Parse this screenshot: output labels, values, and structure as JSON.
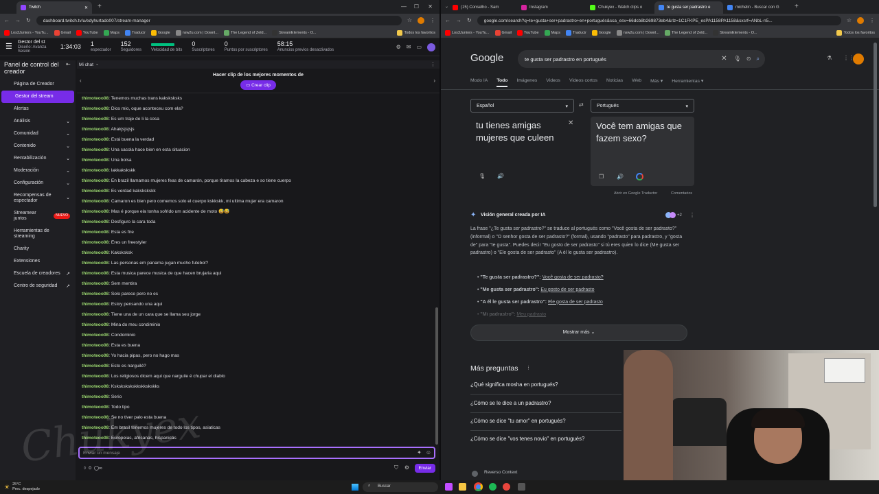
{
  "left_browser": {
    "tab_title": "Twitch",
    "url": "dashboard.twitch.tv/u/edyhurtado007/stream-manager",
    "bookmarks": [
      "Los3Juniors - YouTu...",
      "Gmail",
      "YouTube",
      "Maps",
      "Traducir",
      "Google",
      "nsw2u.com | Downl...",
      "The Legend of Zeld...",
      "StreamElements - O..."
    ],
    "all_bookmarks": "Todos los favoritos"
  },
  "twitch": {
    "header_title": "Gestor del st",
    "header_sub1": "Diseño: Avanza",
    "header_sub2": "Sesión",
    "stats": [
      {
        "value": "1:34:03",
        "label": ""
      },
      {
        "value": "1",
        "label": "espectador"
      },
      {
        "value": "152",
        "label": "Seguidores"
      },
      {
        "value": "",
        "label": "Velocidad de bits"
      },
      {
        "value": "0",
        "label": "Suscriptores"
      },
      {
        "value": "0",
        "label": "Puntos por suscriptores"
      },
      {
        "value": "58:15",
        "label": "Anuncios previos desactivados"
      }
    ],
    "sidebar_title": "Panel de control del creador",
    "sidebar_items": [
      "Página de Creador",
      "Gestor del stream",
      "Alertas",
      "Análisis",
      "Comunidad",
      "Contenido",
      "Rentabilización",
      "Moderación",
      "Configuración",
      "Recompensas de espectador",
      "Streamear juntos",
      "Herramientas de streaming",
      "Charity",
      "Extensiones",
      "Escuela de creadores",
      "Centro de seguridad"
    ],
    "new_badge": "NUEVO",
    "chat_header": "Mi chat",
    "clip_prompt": "Hacer clip de los mejores momentos de",
    "clip_button": "Crear clip",
    "username": "thimoteoo08",
    "messages": [
      "Tenemos muchas trans kaksksksks",
      "Dios mio, oque aconteceu com ela?",
      "Es um traje de li la cosa",
      "Ahakjsjsjsjs",
      "Está buena la verdad",
      "Una sacola hace bien en esta situacion",
      "Una bolsa",
      "lakkakskskk",
      "En brazil llamamos mujeres feas de camarón, porque tiramos la cabeza e so tiene cuerpo",
      "Es verdad kakskskskk",
      "Camaron es bien pero comemos solo el cuerpo kskkskk, mi ultima mujer era camaron",
      "Mas é porque ela tonha sofrido um acidente de moto 😅😅",
      "Desfiguro la cara toda",
      "Esta es fire",
      "Eres un freestyler",
      "Kaksksksk",
      "Las personas em panama jugan mucho futebol?",
      "Esta musica parece musica de que hacen brujaria aqui",
      "Sem mentira",
      "Solo parece pero no es",
      "Estoy pensando una aqui",
      "Tiene una de un cara que se llama seu jorge",
      "Mina do meu condiminio",
      "Condominio",
      "Esta es buena",
      "Yo hacia pipas, pero no hago mas",
      "Esto es narguilé?",
      "Los religiosos dicem aqui que narguile é chupar el diablo",
      "Kskskskskskkskkskskks",
      "Serio",
      "Todo tipo",
      "Se no tiver palo esta buena",
      "Em brasil tenemos mujeres de todo los tipos, asiaticas",
      "Europeias, africanas, hispanicas"
    ],
    "input_placeholder": "Enviar un mensaje",
    "points": "0",
    "send_button": "Enviar"
  },
  "right_browser": {
    "tabs": [
      "(15) Conselho - Sam",
      "Instagram",
      "Chukyex - Watch clips o",
      "te gusta ser padrastro e",
      "michelin - Buscar con G"
    ],
    "url": "google.com/search?q=te+gusta+ser+padrastro+en+portugués&sca_esv=66dcb8b269873eb4&rlz=1C1FKPE_esPA1158PA1158&sxsrf=ANbL-n5...",
    "bookmarks": [
      "Los3Juniors - YouTu...",
      "Gmail",
      "YouTube",
      "Maps",
      "Traducir",
      "Google",
      "nsw2u.com | Downl...",
      "The Legend of Zeld...",
      "StreamElements - O..."
    ],
    "all_bookmarks": "Todos los favoritos"
  },
  "google": {
    "logo": "Google",
    "query": "te gusta ser padrastro en portugués",
    "tabs": [
      "Modo IA",
      "Todo",
      "Imágenes",
      "Videos",
      "Videos cortos",
      "Noticias",
      "Web",
      "Más ▾",
      "Herramientas ▾"
    ],
    "lang_from": "Español",
    "lang_to": "Portugués",
    "source_text": "tu tienes amigas mujeres que culeen",
    "translated_text": "Você tem amigas que fazem sexo?",
    "open_translate": "Abrir en Google Traductor",
    "feedback": "Comentarios",
    "ai_title": "Visión general creada por IA",
    "ai_count": "+2",
    "ai_paragraph": "La frase \"¿Te gusta ser padrastro?\" se traduce al portugués como \"Você gosta de ser padrasto?\" (informal) o \"O senhor gosta de ser padrasto?\" (formal), usando \"padrasto\" para padrastro, y \"gosta de\" para \"te gusta\". Puedes decir \"Eu gosto de ser padrasto\" si tú eres quien lo dice (Me gusta ser padrastro) o \"Ele gosta de ser padrasto\" (A él le gusta ser padrastro).",
    "bullets": [
      {
        "k": "\"Te gusta ser padrastro?\":",
        "v": "Você gosta de ser padrasto?"
      },
      {
        "k": "\"Me gusta ser padrastro\":",
        "v": "Eu gosto de ser padrasto"
      },
      {
        "k": "\"A él le gusta ser padrastro\":",
        "v": "Ele gosta de ser padrasto"
      },
      {
        "k": "\"Mi padrastro\":",
        "v": "Meu padrasto"
      }
    ],
    "show_more": "Mostrar más",
    "more_questions_title": "Más preguntas",
    "questions": [
      "¿Qué significa mosha en portugués?",
      "¿Cómo se le dice a un padrastro?",
      "¿Cómo se dice \"tu amor\" en portugués?",
      "¿Cómo se dice \"vos tenes novio\" en portugués?"
    ],
    "reverso": "Reverso Context"
  },
  "watermark": "Chukyex",
  "taskbar": {
    "temp": "25°C",
    "weather": "Prec. despejado",
    "search": "Buscar"
  },
  "colors": {
    "twitch_purple": "#772ce8",
    "chat_user": "#9bd770",
    "google_bg": "#202124",
    "link": "#8ab4f8"
  }
}
